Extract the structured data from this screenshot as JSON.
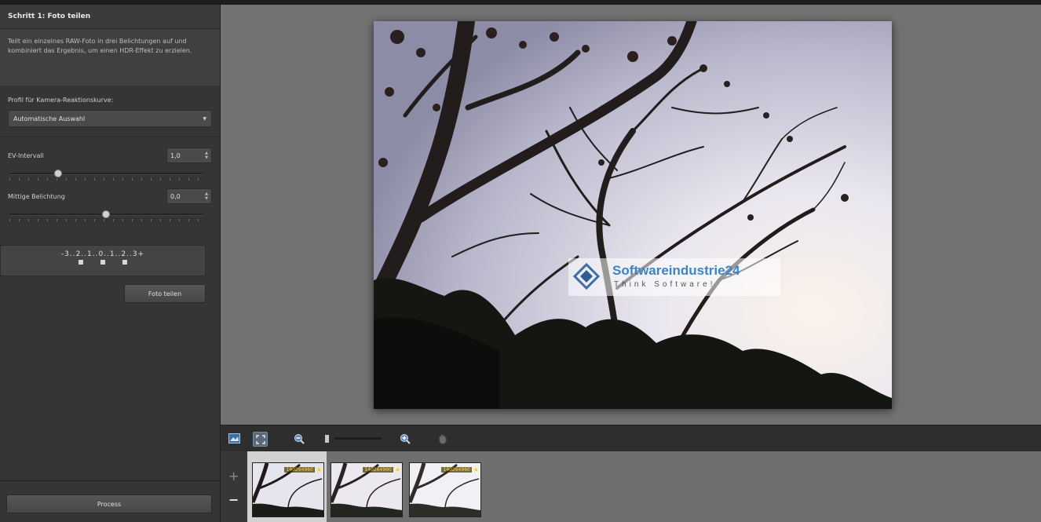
{
  "sidebar": {
    "header": "Schritt 1: Foto teilen",
    "description": "Teilt ein einzelnes RAW-Foto in drei Belichtungen auf und kombiniert das Ergebnis, um einen HDR-Effekt zu erzielen.",
    "profile_label": "Profil für Kamera-Reaktionskurve:",
    "profile_value": "Automatische Auswahl",
    "ev_label": "EV-Intervall",
    "ev_value": "1,0",
    "ev_level": 0.25,
    "exposure_label": "Mittige Belichtung",
    "exposure_value": "0,0",
    "exposure_level": 0.5,
    "scale_text": "-3..2..1..0..1..2..3+",
    "split_button": "Foto teilen",
    "process_button": "Process"
  },
  "watermark": {
    "title": "Softwareindustrie24",
    "subtitle": "Think Software!"
  },
  "toolbar": {
    "icons": [
      "fit-view-icon",
      "fullscreen-icon",
      "zoom-out-icon",
      "zoom-slider-icon",
      "zoom-in-icon",
      "hand-tool-icon"
    ]
  },
  "filmstrip": {
    "plus": "+",
    "minus": "−",
    "thumbs": [
      {
        "badge": "140264960",
        "star": "★"
      },
      {
        "badge": "140264960",
        "star": "★"
      },
      {
        "badge": "140264960",
        "star": "★"
      }
    ]
  },
  "colors": {
    "sidebar_bg": "#353535",
    "canvas_bg": "#727272",
    "accent_blue": "#3c84c4",
    "badge_gold": "#ffd84a"
  }
}
